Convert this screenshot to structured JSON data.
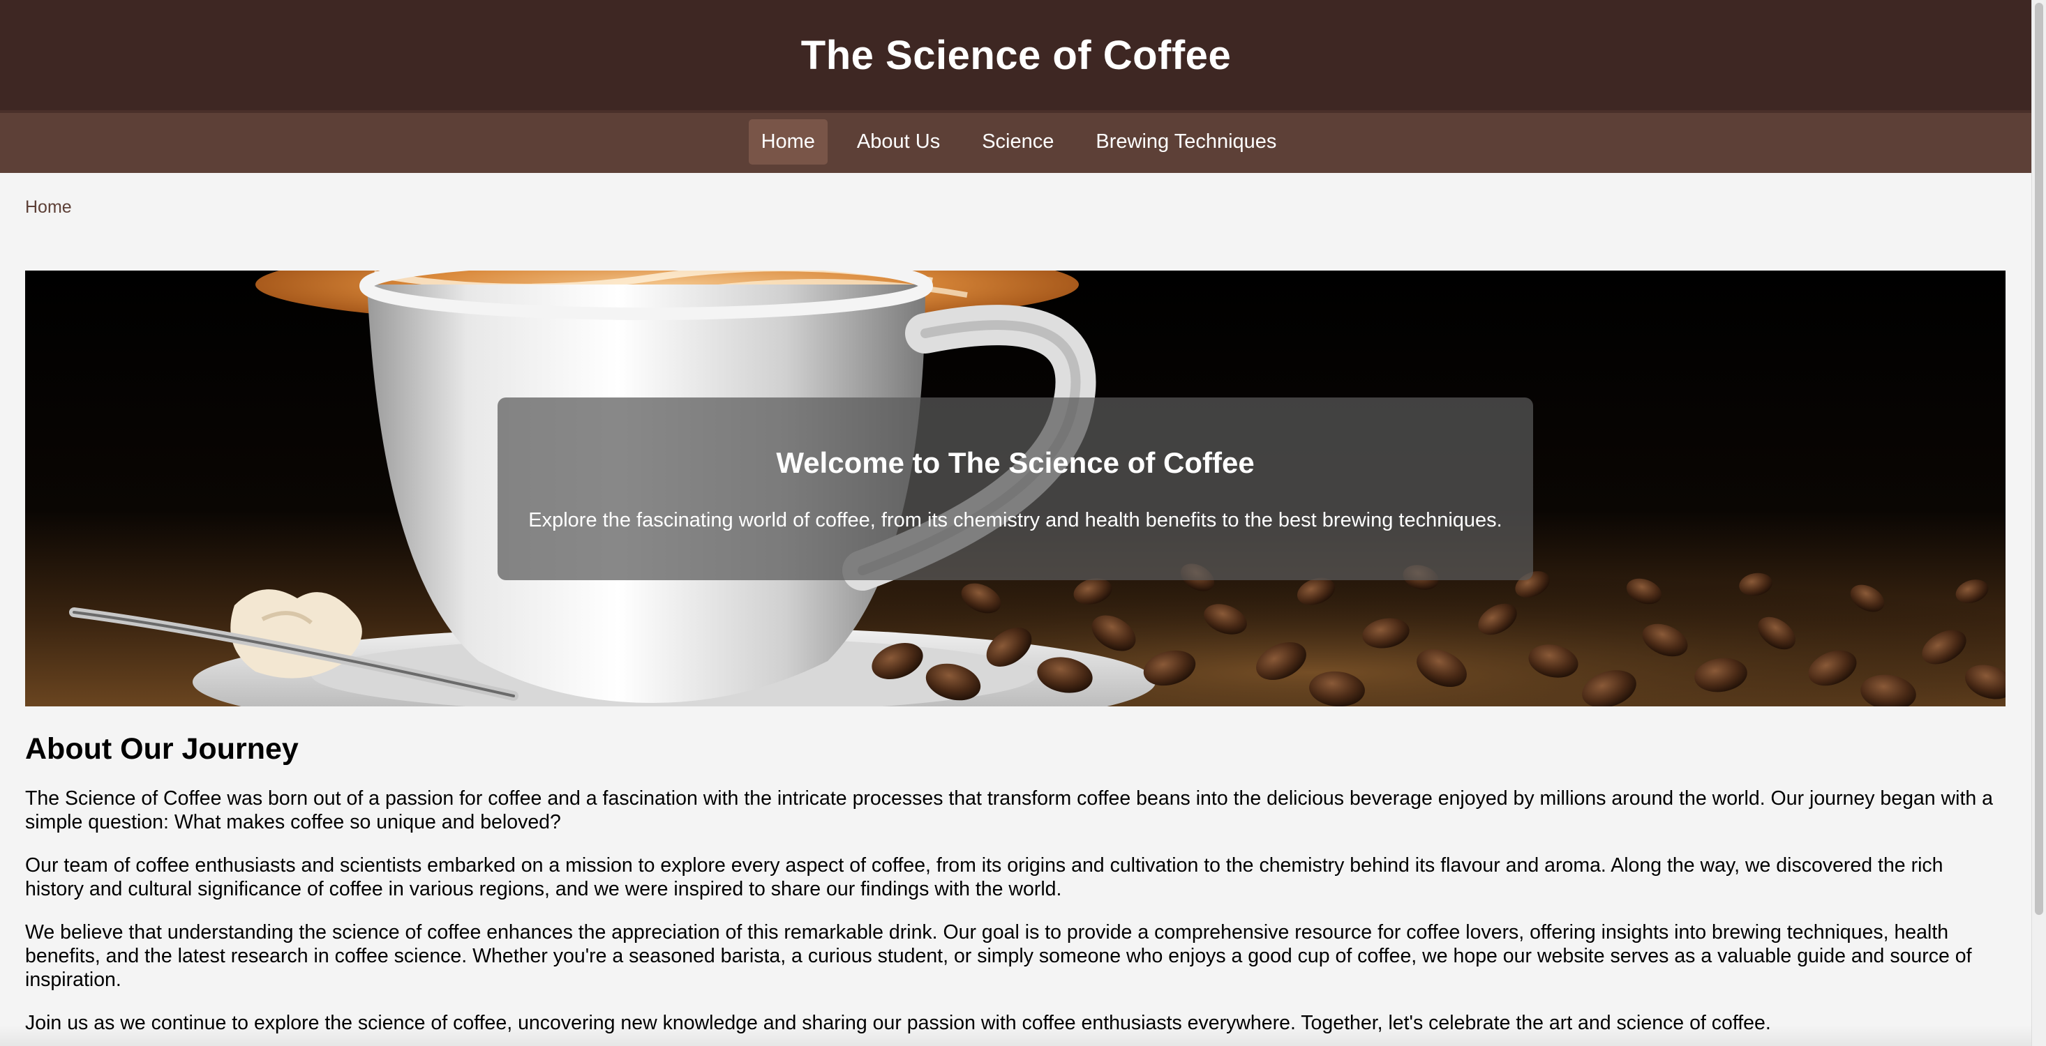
{
  "header": {
    "title": "The Science of Coffee"
  },
  "nav": {
    "items": [
      {
        "label": "Home",
        "active": true
      },
      {
        "label": "About Us",
        "active": false
      },
      {
        "label": "Science",
        "active": false
      },
      {
        "label": "Brewing Techniques",
        "active": false
      }
    ]
  },
  "breadcrumb": {
    "home": "Home"
  },
  "hero": {
    "heading": "Welcome to The Science of Coffee",
    "text": "Explore the fascinating world of coffee, from its chemistry and health benefits to the best brewing techniques."
  },
  "about": {
    "heading": "About Our Journey",
    "paragraphs": [
      "The Science of Coffee was born out of a passion for coffee and a fascination with the intricate processes that transform coffee beans into the delicious beverage enjoyed by millions around the world. Our journey began with a simple question: What makes coffee so unique and beloved?",
      "Our team of coffee enthusiasts and scientists embarked on a mission to explore every aspect of coffee, from its origins and cultivation to the chemistry behind its flavour and aroma. Along the way, we discovered the rich history and cultural significance of coffee in various regions, and we were inspired to share our findings with the world.",
      "We believe that understanding the science of coffee enhances the appreciation of this remarkable drink. Our goal is to provide a comprehensive resource for coffee lovers, offering insights into brewing techniques, health benefits, and the latest research in coffee science. Whether you're a seasoned barista, a curious student, or simply someone who enjoys a good cup of coffee, we hope our website serves as a valuable guide and source of inspiration.",
      "Join us as we continue to explore the science of coffee, uncovering new knowledge and sharing our passion with coffee enthusiasts everywhere. Together, let's celebrate the art and science of coffee."
    ]
  },
  "colors": {
    "header_bg": "#3e2723",
    "nav_bg": "#5d4037",
    "nav_active_bg": "#795548",
    "page_bg": "#f4f4f4",
    "breadcrumb_link": "#5d4037"
  }
}
